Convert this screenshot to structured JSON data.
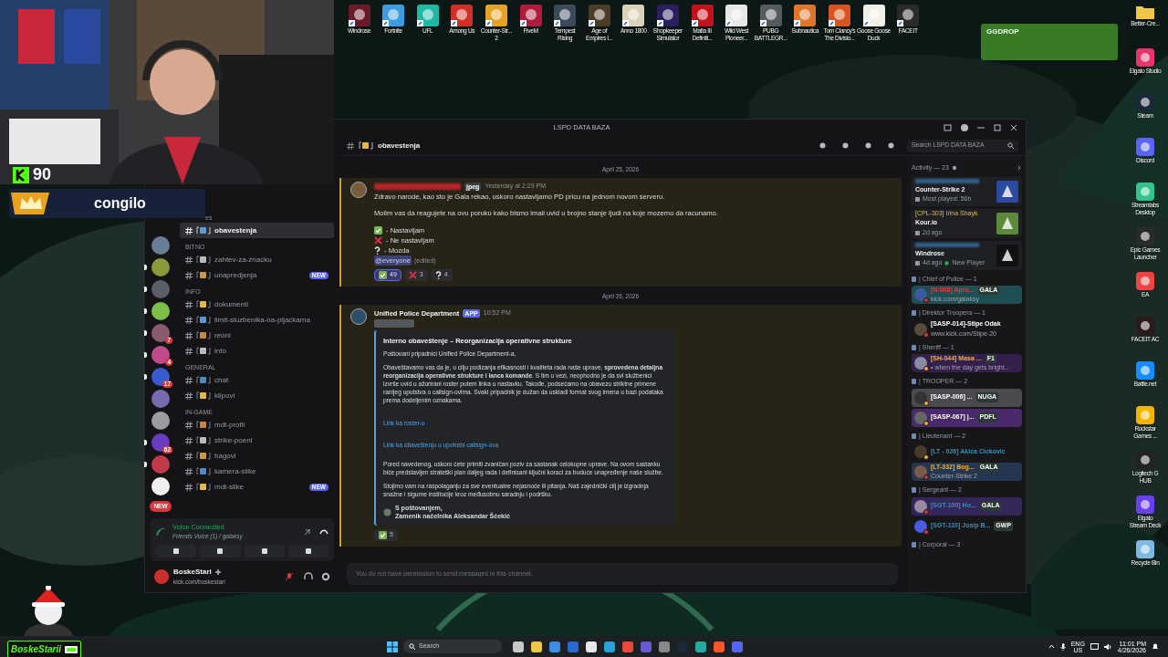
{
  "webcam": {
    "kind": "picture",
    "follower_count": "90",
    "viewer_name": "congilo"
  },
  "desktop_icons_top": [
    {
      "lines": [
        "Windrose"
      ]
    },
    {
      "lines": [
        "Fortnite"
      ]
    },
    {
      "lines": [
        "UFL"
      ]
    },
    {
      "lines": [
        "Among Us"
      ]
    },
    {
      "lines": [
        "Counter-Str...",
        "2"
      ]
    },
    {
      "lines": [
        "FiveM"
      ]
    },
    {
      "lines": [
        "Tempest",
        "Rising"
      ]
    },
    {
      "lines": [
        "Age of",
        "Empires I..."
      ]
    },
    {
      "lines": [
        "Anno 1800"
      ]
    },
    {
      "lines": [
        "Shopkeeper",
        "Simulator"
      ]
    },
    {
      "lines": [
        "Mafia III",
        "Definiti..."
      ]
    },
    {
      "lines": [
        "Wild West",
        "Pioneer..."
      ]
    },
    {
      "lines": [
        "PUBG",
        "BATTLEGR..."
      ]
    },
    {
      "lines": [
        "Subnautica"
      ]
    },
    {
      "lines": [
        "Tom Clancy's",
        "The Divisio..."
      ]
    },
    {
      "lines": [
        "Goose Goose",
        "Duck"
      ]
    },
    {
      "lines": [
        "FACEIT"
      ]
    }
  ],
  "desktop_icons_right": [
    {
      "lines": [
        "Better-Cre..."
      ]
    },
    {
      "lines": [
        "Elgato Studio"
      ]
    },
    {
      "lines": [
        "Steam"
      ]
    },
    {
      "lines": [
        "Discord"
      ]
    },
    {
      "lines": [
        "Streamlabs",
        "Desktop"
      ]
    },
    {
      "lines": [
        "Epic Games",
        "Launcher"
      ]
    },
    {
      "lines": [
        "EA"
      ]
    },
    {
      "lines": [
        "FACEIT AC"
      ]
    },
    {
      "lines": [
        "Battle.net"
      ]
    },
    {
      "lines": [
        "Rockstar",
        "Games ..."
      ]
    },
    {
      "lines": [
        "Logitech G",
        "HUB"
      ]
    },
    {
      "lines": [
        "Elgato",
        "Stream Deck"
      ]
    },
    {
      "lines": [
        "Recycle Bin"
      ]
    }
  ],
  "stream_overlay": {
    "banner": "GGDROP",
    "streamer": "BoskeStarii"
  },
  "discord": {
    "title": "LSPD DATA BAZA",
    "channel_header": "obavestenja",
    "search": {
      "placeholder": "Search LSPD DATA BAZA"
    },
    "servers": [
      {
        "unread": false
      },
      {
        "unread": true
      },
      {
        "unread": true
      },
      {
        "unread": true
      },
      {
        "unread": true,
        "badge": "7"
      },
      {
        "unread": true,
        "badge": "4"
      },
      {
        "unread": true,
        "badge": "17"
      },
      {
        "unread": false
      },
      {
        "unread": false
      },
      {
        "unread": true,
        "badge": "62"
      },
      {
        "unread": true
      },
      {
        "unread": false
      }
    ],
    "servers_new": "NEW",
    "channels": [
      {
        "kind": "category",
        "name": "es",
        "cut": true
      },
      {
        "kind": "channel",
        "name": "obavestenja",
        "selected": true
      },
      {
        "kind": "category",
        "name": "BITNO"
      },
      {
        "kind": "channel",
        "name": "zahtev-za-znacku",
        "selected": false
      },
      {
        "kind": "channel",
        "name": "unapredjenja",
        "selected": false,
        "badge": "NEW"
      },
      {
        "kind": "category",
        "name": "INFO"
      },
      {
        "kind": "channel",
        "name": "dokumenti",
        "selected": false
      },
      {
        "kind": "channel",
        "name": "limit-sluzbenika-na-pljackama",
        "selected": false
      },
      {
        "kind": "channel",
        "name": "reoni",
        "selected": false
      },
      {
        "kind": "channel",
        "name": "info",
        "selected": false
      },
      {
        "kind": "category",
        "name": "GENERAL"
      },
      {
        "kind": "channel",
        "name": "chat",
        "selected": false
      },
      {
        "kind": "channel",
        "name": "klipovi",
        "selected": false
      },
      {
        "kind": "category",
        "name": "IN-GAME"
      },
      {
        "kind": "channel",
        "name": "mdt-profil",
        "selected": false
      },
      {
        "kind": "channel",
        "name": "strike-poeni",
        "selected": false
      },
      {
        "kind": "channel",
        "name": "bagovi",
        "selected": false
      },
      {
        "kind": "channel",
        "name": "kamera-slike",
        "selected": false
      },
      {
        "kind": "channel",
        "name": "mdt-slike",
        "selected": false,
        "badge": "NEW"
      }
    ],
    "voice": {
      "status": "Voice Connected",
      "channel": "Friends Voice (1) / galaksy"
    },
    "user": {
      "name": "BoskeStari",
      "status": "kick.com/boskestari"
    },
    "messages": [
      {
        "kind": "date",
        "text": "April 25, 2026"
      },
      {
        "kind": "message",
        "author_hidden": true,
        "tag": "jpeg",
        "time": "Yesterday at 2:29 PM",
        "paragraphs": [
          "Zdravo narode, kao sto je Gala rekao, uskoro nastavljamo PD pricu na jednom novom serveru.",
          "Molim vas da reagujete na ovu poruku kako bismo imali uvid u brojno stanje ljudi na koje mozemo da racunamo."
        ],
        "options": [
          {
            "kind": "check",
            "text": "- Nastavljam"
          },
          {
            "kind": "cross",
            "text": "- Ne nastavljam"
          },
          {
            "kind": "question",
            "text": "- Mozda"
          }
        ],
        "mention": "@everyone",
        "edited": "(edited)",
        "reactions": [
          {
            "kind": "check",
            "count": "49",
            "selected": true
          },
          {
            "kind": "cross",
            "count": "3",
            "selected": false
          },
          {
            "kind": "question",
            "count": "4",
            "selected": false
          }
        ]
      },
      {
        "kind": "date",
        "text": "April 26, 2026"
      },
      {
        "kind": "message",
        "author": "Unified Police Department",
        "tag": "APP",
        "time": "10:52 PM",
        "redacted_line": true,
        "embed": {
          "title": "Interno obaveštenje – Reorganizacija operativne strukture",
          "blocks": [
            {
              "kind": "text",
              "text": "Poštovani pripadnici Unified Police Department-a,"
            },
            {
              "kind": "text",
              "text": "Obaveštavamo vas da je, u cilju podizanja efikasnosti i kvaliteta rada naše uprave, **sprovedena detaljna reorganizacija operativne strukture i lanca komande**. S tim u vezi, neophodno je da svi službenici izvrše uvid u ažurirani roster putem linka u nastavku. Takođe, podsećamo na obavezu striktne primene ranijeg uputstva o callsign-ovima. Svaki pripadnik je dužan da uskladi format svog imena u bazi podataka prema dodeljenim oznakama."
            },
            {
              "kind": "links",
              "items": [
                "Link ka roster-u",
                "Link ka obaveštenju o upotrebi callsign-ova"
              ]
            },
            {
              "kind": "text",
              "text": "Pored navedenog, uskoro ćete primiti zvaničan poziv za sastanak celokupne uprave. Na ovom sastanku biće predstavljen strateški plan daljeg rada i definisani ključni koraci za buduće unapređenje naše službe."
            },
            {
              "kind": "text",
              "text": "Stojimo vam na raspolaganju za sve eventualne nejasnoće ili pitanja. Naš zajednički cilj je izgradnja snažne i sigurne institucije kroz međusobnu saradnju i podršku."
            }
          ],
          "footer": [
            "S poštovanjem,",
            "Zamenik načelnika Aleksandar Šćekić"
          ]
        },
        "reactions": [
          {
            "kind": "check",
            "count": "5",
            "selected": false
          }
        ]
      }
    ],
    "composer": {
      "placeholder": "You do not have permission to send messages in this channel."
    },
    "activity": {
      "title": "Activity — 23",
      "cards": [
        {
          "user_hidden": true,
          "game": "Counter-Strike 2",
          "detail": "Most played: 56h"
        },
        {
          "user": "[CPL-303] Irina Shayk",
          "game": "Kour.io",
          "detail": "2d ago"
        },
        {
          "user_hidden": true,
          "game": "Windrose",
          "detail": "4d ago",
          "extra": "New Player"
        }
      ]
    },
    "groups": [
      {
        "title": "| Chief of Police — 1",
        "members": [
          {
            "name": "[N-008] Apro...",
            "color": "#e03c3c",
            "idle": false,
            "subtitle": "kick.com/galaksy",
            "tag": "GALA",
            "nameplate": {
              "color": "#1d4f55"
            }
          }
        ]
      },
      {
        "title": "| Direktor Troopera — 1",
        "members": [
          {
            "name": "[SASP-014]-Stipe Odak",
            "color": "#ffffff",
            "idle": false,
            "subtitle": "www.kick.com/Stipe-20"
          }
        ]
      },
      {
        "title": "| Sheriff — 1",
        "members": [
          {
            "name": "[SH-044] Masa ...",
            "color": "#f0b232",
            "idle": true,
            "subtitle": "• when the day gets bright...",
            "tag": "F1",
            "nameplate": {
              "color": "#35204d"
            }
          }
        ]
      },
      {
        "title": "| TROOPER — 2",
        "members": [
          {
            "name": "[SASP-006] ...",
            "color": "#ffffff",
            "idle": true,
            "tag": "NUGA",
            "nameplate": {
              "color": "#4a4a4e"
            }
          },
          {
            "name": "[SASP-067] |...",
            "color": "#ffffff",
            "idle": true,
            "tag": "PDFL",
            "nameplate": {
              "color": "#4a2a6a"
            }
          }
        ]
      },
      {
        "title": "| Lieutenant — 2",
        "members": [
          {
            "name": "[LT - 026] Akica Cickovic",
            "color": "#3b8fb5",
            "idle": true
          },
          {
            "name": "[LT-332] Bog...",
            "color": "#f0b232",
            "idle": false,
            "subtitle": "Counter-Strike 2",
            "tag": "GALA",
            "nameplate": {
              "color": "#243650"
            }
          }
        ]
      },
      {
        "title": "| Sergeant — 2",
        "members": [
          {
            "name": "[SGT-100] Ho...",
            "color": "#3b8fb5",
            "idle": false,
            "tag": "GALA",
            "nameplate": {
              "color": "#33265a"
            }
          },
          {
            "name": "[SGT-110] Josip B...",
            "color": "#3b8fb5",
            "idle": false,
            "tag": "GWP"
          }
        ]
      },
      {
        "title": "| Corporal — 3"
      }
    ]
  },
  "taskbar": {
    "search_placeholder": "Search",
    "language": [
      "ENG",
      "US"
    ],
    "time": "11:01 PM",
    "date": "4/26/2026"
  }
}
